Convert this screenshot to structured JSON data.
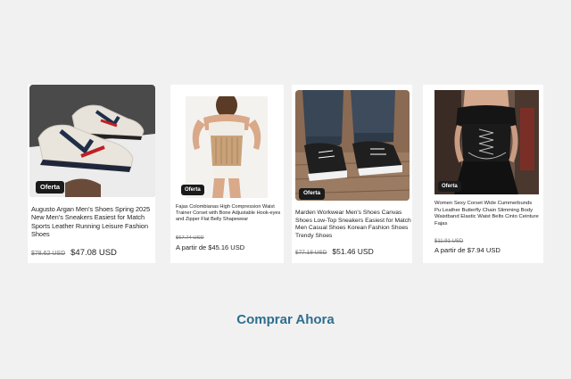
{
  "products": [
    {
      "badge": "Oferta",
      "title": "Augusto Argan Men's Shoes Spring 2025 New Men's Sneakers Easiest for Match Sports Leather Running Leisure Fashion Shoes",
      "old_price": "$78.62 USD",
      "new_price": "$47.08 USD",
      "image": "sneakers-image"
    },
    {
      "badge": "Oferta",
      "title": "Fajas Colombianas High Compression Waist Trainer Corset with Bone Adjustable Hook-eyes and Zipper Flat Belly Shapewear",
      "old_price": "$67.74 USD",
      "new_price": "A partir de $45.16 USD",
      "image": "shapewear-image"
    },
    {
      "badge": "Oferta",
      "title": "Marden Workwear Men's Shoes Canvas Shoes Low-Top Sneakers Easiest for Match Men Casual Shoes Korean Fashion Shoes Trendy Shoes",
      "old_price": "$77.18 USD",
      "new_price": "$51.46 USD",
      "image": "canvas-shoes-image"
    },
    {
      "badge": "Oferta",
      "title": "Women Sexy Corset Wide Cummerbunds Pu Leather Butterfly Chain Slimming Body Waistband Elastic Waist Belts Cinto Ceinture Fajas",
      "old_price": "$11.91 USD",
      "new_price": "A partir de $7.94 USD",
      "image": "corset-belt-image"
    }
  ],
  "cta": {
    "label": "Comprar Ahora",
    "color": "#2e6e8e"
  },
  "colors": {
    "background": "#f1f1f1",
    "badge": "#1b1b1b"
  }
}
